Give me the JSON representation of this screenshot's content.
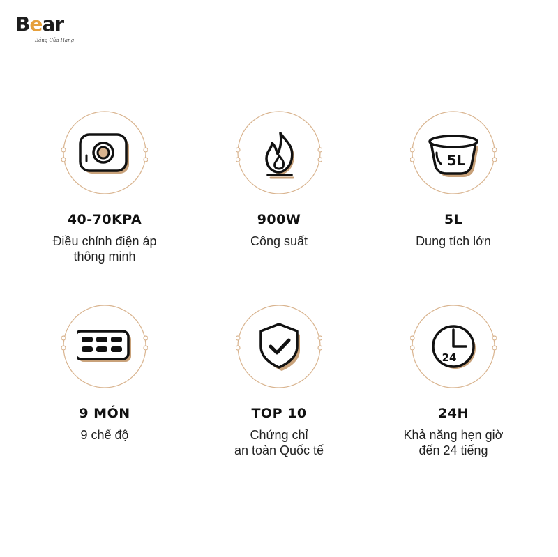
{
  "brand": {
    "name_main": "B",
    "name_dot": "e",
    "name_end": "ar",
    "tagline": "Bảng Của Hạng"
  },
  "colors": {
    "accent": "#d9b48f",
    "shadow": "#c9a27a",
    "ink": "#111111"
  },
  "features": [
    {
      "icon": "pressure-gauge-icon",
      "title": "40-70KPA",
      "desc": [
        "Điều chỉnh điện áp",
        "thông minh"
      ]
    },
    {
      "icon": "flame-icon",
      "title": "900W",
      "desc": [
        "Công suất"
      ]
    },
    {
      "icon": "pot-capacity-icon",
      "icon_text": "5L",
      "title": "5L",
      "desc": [
        "Dung tích lớn"
      ]
    },
    {
      "icon": "menu-modes-icon",
      "title": "9 MÓN",
      "desc": [
        "9 chế độ"
      ]
    },
    {
      "icon": "shield-check-icon",
      "title": "TOP 10",
      "desc": [
        "Chứng chỉ",
        "an toàn Quốc tế"
      ]
    },
    {
      "icon": "clock-24-icon",
      "icon_text": "24",
      "title": "24H",
      "desc": [
        "Khả năng hẹn giờ",
        "đến 24 tiếng"
      ]
    }
  ]
}
